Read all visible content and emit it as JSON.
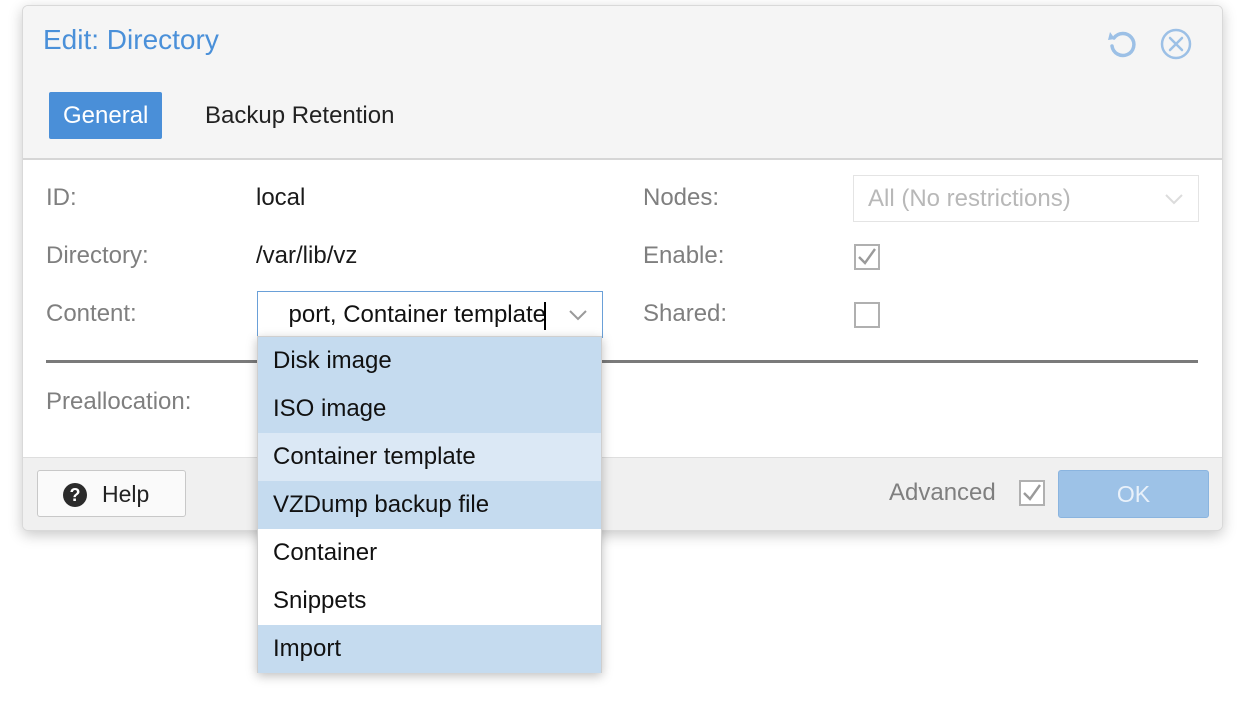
{
  "dialog": {
    "title": "Edit: Directory",
    "icons": {
      "reset": "reset-icon",
      "close": "close-icon"
    }
  },
  "tabs": [
    {
      "label": "General",
      "active": true
    },
    {
      "label": "Backup Retention",
      "active": false
    }
  ],
  "form": {
    "id_label": "ID:",
    "id_value": "local",
    "directory_label": "Directory:",
    "directory_value": "/var/lib/vz",
    "content_label": "Content:",
    "content_value": "port, Container template",
    "nodes_label": "Nodes:",
    "nodes_value": "All (No restrictions)",
    "enable_label": "Enable:",
    "enable_checked": true,
    "shared_label": "Shared:",
    "shared_checked": false,
    "preallocation_label": "Preallocation:"
  },
  "content_dropdown": {
    "options": [
      {
        "label": "Disk image",
        "selected": true
      },
      {
        "label": "ISO image",
        "selected": true
      },
      {
        "label": "Container template",
        "selected": true,
        "hovered": true
      },
      {
        "label": "VZDump backup file",
        "selected": true
      },
      {
        "label": "Container",
        "selected": false
      },
      {
        "label": "Snippets",
        "selected": false
      },
      {
        "label": "Import",
        "selected": true
      }
    ]
  },
  "footer": {
    "help_label": "Help",
    "advanced_label": "Advanced",
    "advanced_checked": true,
    "ok_label": "OK"
  },
  "colors": {
    "accent": "#4a90d9",
    "selected_option": "#c5dbef",
    "ok_disabled": "#9dc2e7"
  }
}
